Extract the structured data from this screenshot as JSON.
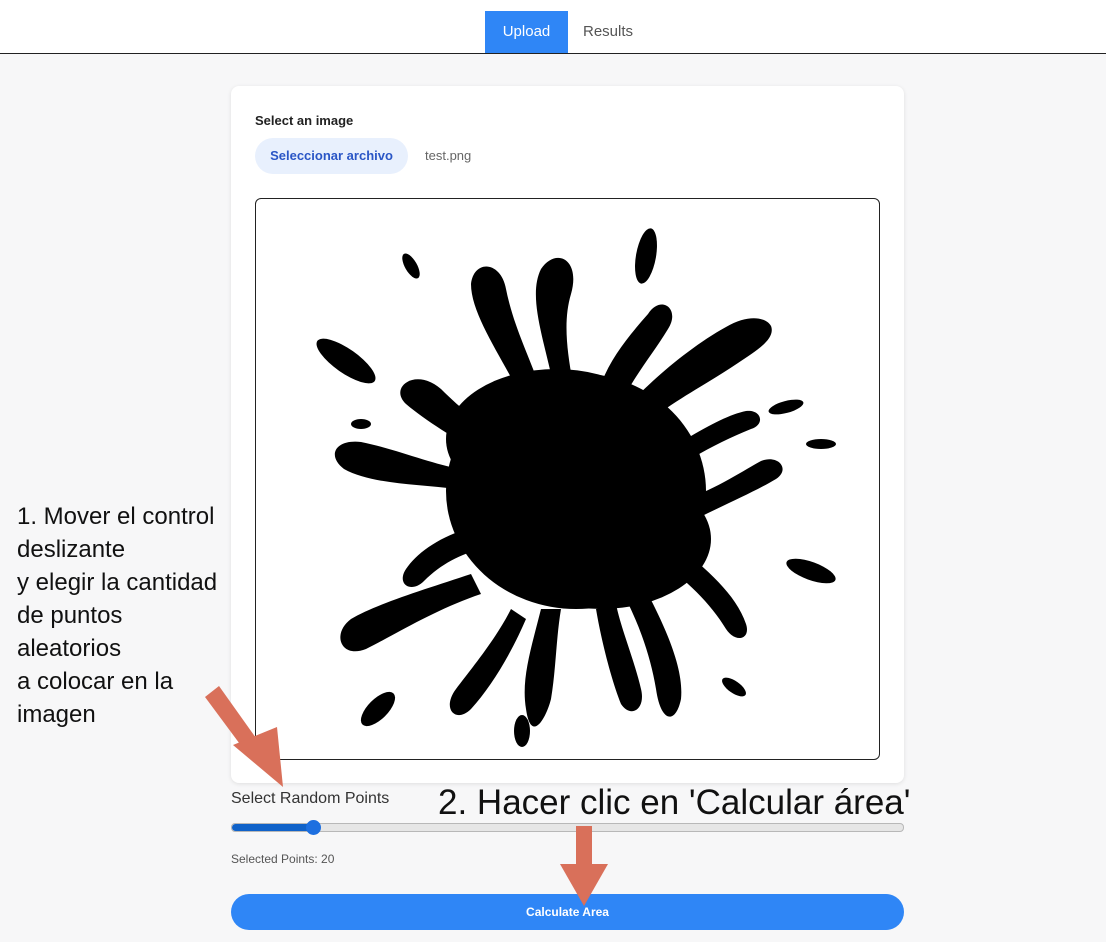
{
  "nav": {
    "tabs": [
      {
        "label": "Upload",
        "active": true
      },
      {
        "label": "Results",
        "active": false
      }
    ]
  },
  "upload": {
    "select_label": "Select an image",
    "file_button_label": "Seleccionar archivo",
    "file_name": "test.png"
  },
  "slider": {
    "title": "Select Random Points",
    "fill_fraction": 0.12,
    "selected_text": "Selected Points: 20"
  },
  "actions": {
    "calculate_label": "Calculate Area"
  },
  "annotations": {
    "step1_lines": [
      "1. Mover el control",
      "deslizante",
      "y elegir la cantidad",
      "de puntos",
      "aleatorios",
      "a colocar en la",
      "imagen"
    ],
    "step2": "2. Hacer clic en 'Calcular área'"
  },
  "colors": {
    "accent": "#2f86f6",
    "slider_fill": "#1062c9",
    "arrow": "#d9705a",
    "splat": "#000000"
  },
  "icons": {
    "arrows": "arrow-icon"
  }
}
